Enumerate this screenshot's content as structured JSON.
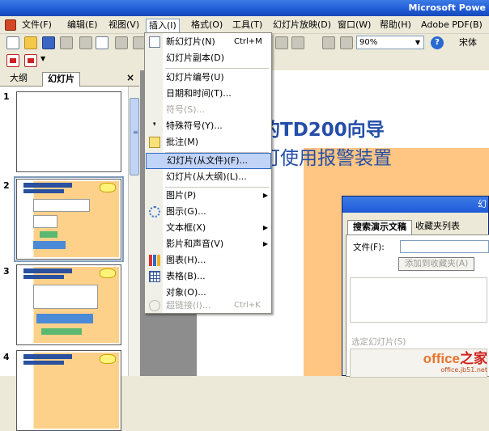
{
  "window": {
    "title": "Microsoft Powe"
  },
  "menubar": {
    "items": [
      {
        "label": "文件(F)"
      },
      {
        "label": "编辑(E)"
      },
      {
        "label": "视图(V)"
      },
      {
        "label": "插入(I)"
      },
      {
        "label": "格式(O)"
      },
      {
        "label": "工具(T)"
      },
      {
        "label": "幻灯片放映(D)"
      },
      {
        "label": "窗口(W)"
      },
      {
        "label": "帮助(H)"
      },
      {
        "label": "Adobe PDF(B)"
      }
    ]
  },
  "toolbar": {
    "zoom": "90%",
    "font": "宋体",
    "help_glyph": "?"
  },
  "panel": {
    "tabs": [
      {
        "label": "大纲"
      },
      {
        "label": "幻灯片"
      }
    ],
    "close": "×",
    "slide_numbers": [
      "1",
      "2",
      "3",
      "4"
    ]
  },
  "slide": {
    "title_line1": "的TD200向导",
    "title_line2": "可使用报警装置"
  },
  "dialog": {
    "caption": "幻",
    "tabs": [
      {
        "label": "搜索演示文稿"
      },
      {
        "label": "收藏夹列表"
      }
    ],
    "file_label": "文件(F):",
    "add_button": "添加到收藏夹(A)",
    "selected_label": "选定幻灯片(S)"
  },
  "insert_menu": {
    "items": [
      {
        "label": "新幻灯片(N)",
        "shortcut": "Ctrl+M",
        "icon": "new-slide-icon"
      },
      {
        "label": "幻灯片副本(D)"
      },
      {
        "label": "幻灯片编号(U)"
      },
      {
        "label": "日期和时间(T)..."
      },
      {
        "label": "符号(S)..."
      },
      {
        "label": "特殊符号(Y)...",
        "icon": "special-symbol-icon"
      },
      {
        "label": "批注(M)",
        "icon": "comment-icon"
      },
      {
        "label": "幻灯片(从文件)(F)..."
      },
      {
        "label": "幻灯片(从大纲)(L)..."
      },
      {
        "label": "图片(P)"
      },
      {
        "label": "图示(G)...",
        "icon": "diagram-icon"
      },
      {
        "label": "文本框(X)"
      },
      {
        "label": "影片和声音(V)"
      },
      {
        "label": "图表(H)...",
        "icon": "chart-icon"
      },
      {
        "label": "表格(B)...",
        "icon": "table-icon"
      },
      {
        "label": "对象(O)..."
      },
      {
        "label": "超链接(I)...",
        "shortcut": "Ctrl+K",
        "icon": "hyperlink-icon"
      }
    ]
  },
  "watermark": {
    "brand": "office",
    "brand_suffix": "之家",
    "url": "office.jb51.net"
  }
}
